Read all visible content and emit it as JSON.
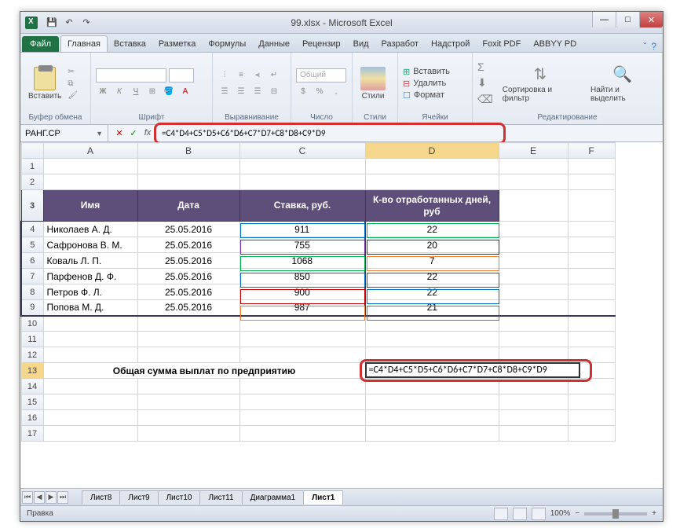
{
  "title": "99.xlsx - Microsoft Excel",
  "qat": {
    "save": "💾",
    "undo": "↶",
    "redo": "↷"
  },
  "tabs": {
    "file": "Файл",
    "items": [
      "Главная",
      "Вставка",
      "Разметка",
      "Формулы",
      "Данные",
      "Рецензир",
      "Вид",
      "Разработ",
      "Надстрой",
      "Foxit PDF",
      "ABBYY PD"
    ]
  },
  "ribbon": {
    "paste": "Вставить",
    "clipboard": "Буфер обмена",
    "font": "Шрифт",
    "alignment": "Выравнивание",
    "number": "Число",
    "number_format": "Общий",
    "styles": "Стили",
    "styles_btn": "Стили",
    "cells": "Ячейки",
    "insert": "Вставить",
    "delete": "Удалить",
    "format": "Формат",
    "editing": "Редактирование",
    "sort": "Сортировка и фильтр",
    "find": "Найти и выделить"
  },
  "namebox": "РАНГ.СР",
  "formula": "=C4*D4+C5*D5+C6*D6+C7*D7+C8*D8+C9*D9",
  "cols": [
    "A",
    "B",
    "C",
    "D",
    "E",
    "F"
  ],
  "headers": {
    "name": "Имя",
    "date": "Дата",
    "rate": "Ставка, руб.",
    "days": "К-во отработанных дней, руб"
  },
  "rows": [
    {
      "name": "Николаев А. Д.",
      "date": "25.05.2016",
      "rate": "911",
      "days": "22"
    },
    {
      "name": "Сафронова В. М.",
      "date": "25.05.2016",
      "rate": "755",
      "days": "20"
    },
    {
      "name": "Коваль Л. П.",
      "date": "25.05.2016",
      "rate": "1068",
      "days": "7"
    },
    {
      "name": "Парфенов Д. Ф.",
      "date": "25.05.2016",
      "rate": "850",
      "days": "22"
    },
    {
      "name": "Петров Ф. Л.",
      "date": "25.05.2016",
      "rate": "900",
      "days": "22"
    },
    {
      "name": "Попова М. Д.",
      "date": "25.05.2016",
      "rate": "987",
      "days": "21"
    }
  ],
  "total_label": "Общая сумма выплат по предприятию",
  "total_formula": "=C4*D4+C5*D5+C6*D6+C7*D7+C8*D8+C9*D9",
  "sheets": [
    "Лист8",
    "Лист9",
    "Лист10",
    "Лист11",
    "Диаграмма1",
    "Лист1"
  ],
  "status": "Правка",
  "zoom": "100%",
  "winbtns": {
    "min": "—",
    "max": "□",
    "close": "✕"
  },
  "fb": {
    "cancel": "✕",
    "enter": "✓",
    "fx": "fx"
  }
}
